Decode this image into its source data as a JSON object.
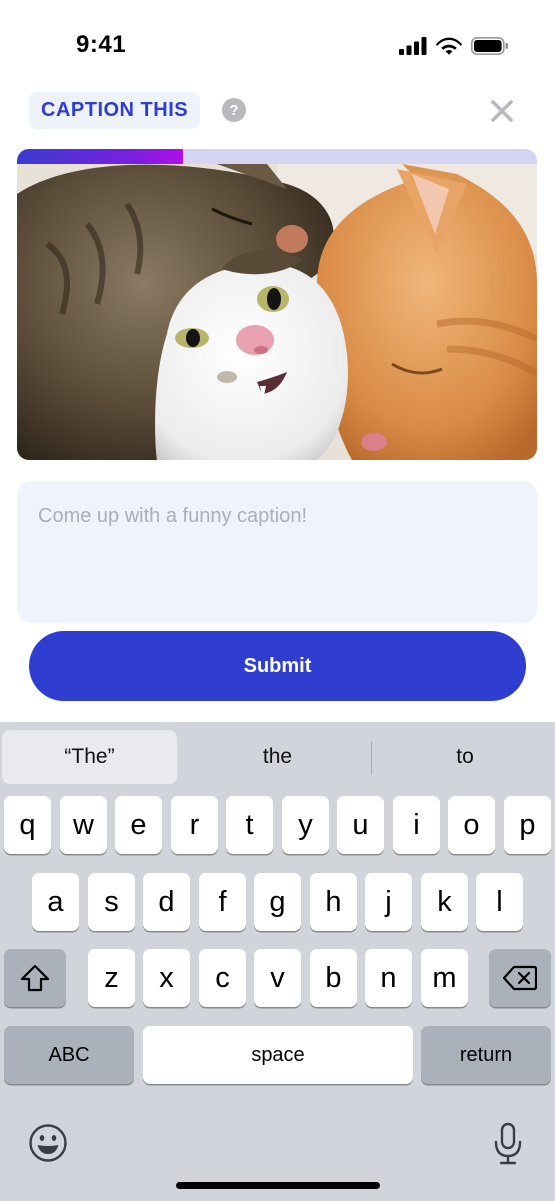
{
  "status_bar": {
    "time": "9:41"
  },
  "header": {
    "title": "CAPTION THIS",
    "help_icon": "?"
  },
  "progress": {
    "fraction": 0.32
  },
  "image": {
    "alt": ""
  },
  "caption": {
    "placeholder": "Come up with a funny caption!",
    "value": ""
  },
  "submit": {
    "label": "Submit"
  },
  "keyboard": {
    "suggestions": [
      "“The”",
      "the",
      "to"
    ],
    "row1": [
      "q",
      "w",
      "e",
      "r",
      "t",
      "y",
      "u",
      "i",
      "o",
      "p"
    ],
    "row2": [
      "a",
      "s",
      "d",
      "f",
      "g",
      "h",
      "j",
      "k",
      "l"
    ],
    "row3": [
      "z",
      "x",
      "c",
      "v",
      "b",
      "n",
      "m"
    ],
    "abc_label": "ABC",
    "space_label": "space",
    "return_label": "return"
  },
  "colors": {
    "accent": "#2f3dd0",
    "input_bg": "#eef3fc",
    "keyboard_bg": "#d1d5db"
  }
}
